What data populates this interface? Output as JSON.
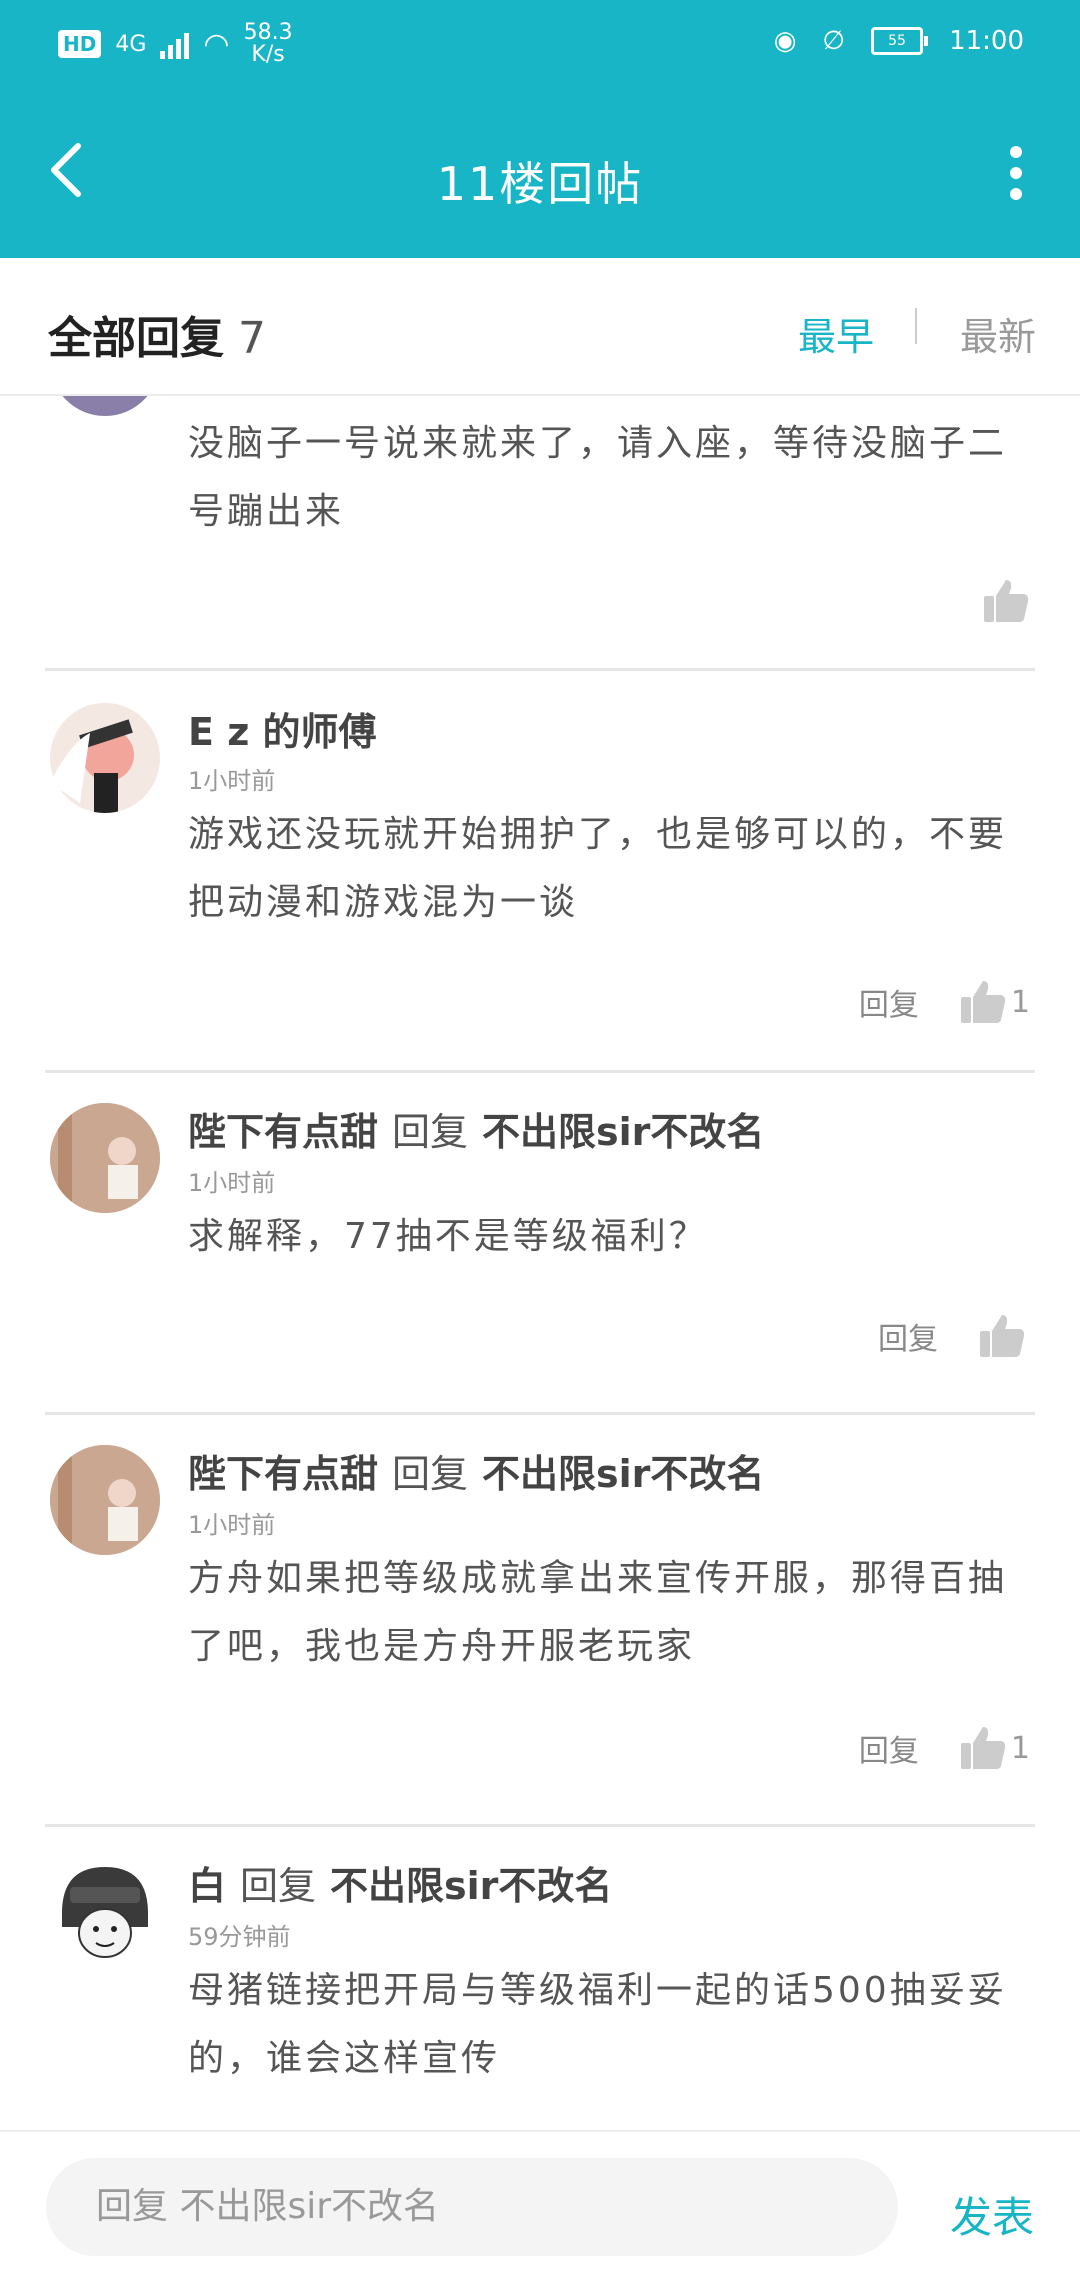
{
  "status_bar": {
    "hd": "HD",
    "network": "4G",
    "speed_value": "58.3",
    "speed_unit": "K/s",
    "time": "11:00",
    "battery": "55"
  },
  "nav": {
    "title": "11楼回帖"
  },
  "tabs": {
    "all_label": "全部回复",
    "count": "7",
    "earliest": "最早",
    "latest": "最新"
  },
  "comments": [
    {
      "content": "没脑子一号说来就来了，请入座，等待没脑子二号蹦出来",
      "like_count": ""
    },
    {
      "user": "E z 的师傅",
      "time": "1小时前",
      "content": "游戏还没玩就开始拥护了，也是够可以的，不要把动漫和游戏混为一谈",
      "reply_label": "回复",
      "like_count": "1"
    },
    {
      "user": "陛下有点甜",
      "reply_word": "回复",
      "reply_to": "不出限sir不改名",
      "time": "1小时前",
      "content": "求解释，77抽不是等级福利？",
      "reply_label": "回复",
      "like_count": ""
    },
    {
      "user": "陛下有点甜",
      "reply_word": "回复",
      "reply_to": "不出限sir不改名",
      "time": "1小时前",
      "content": "方舟如果把等级成就拿出来宣传开服，那得百抽了吧，我也是方舟开服老玩家",
      "reply_label": "回复",
      "like_count": "1"
    },
    {
      "user": "白",
      "reply_word": "回复",
      "reply_to": "不出限sir不改名",
      "time": "59分钟前",
      "content": "母猪链接把开局与等级福利一起的话500抽妥妥的，谁会这样宣传"
    }
  ],
  "bottom": {
    "input_placeholder": "回复 不出限sir不改名",
    "publish": "发表"
  },
  "colors": {
    "accent": "#17b5c6"
  }
}
